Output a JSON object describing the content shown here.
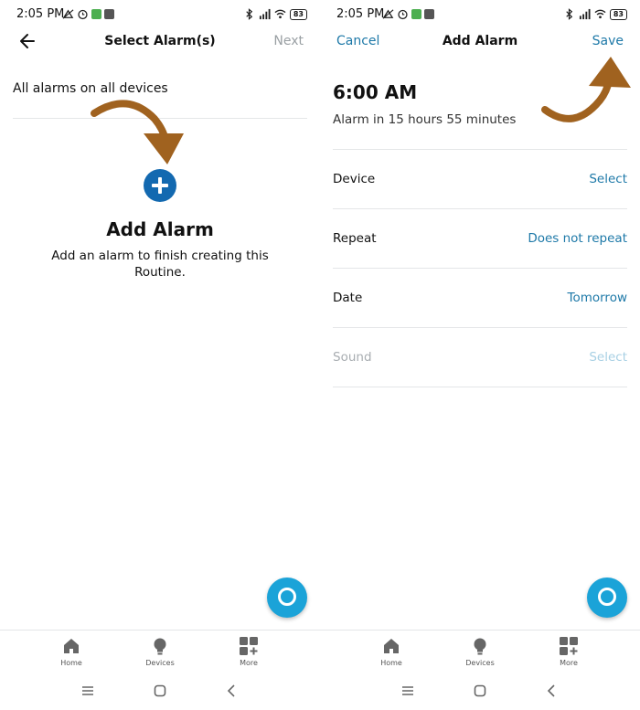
{
  "status_bar": {
    "time": "2:05 PM",
    "battery": "83",
    "icons": [
      "notification-icon",
      "alarm-clock-icon",
      "app-icon",
      "app-icon",
      "bluetooth-icon",
      "signal-icon",
      "wifi-icon",
      "battery-icon"
    ]
  },
  "left_screen": {
    "title": "Select Alarm(s)",
    "next_label": "Next",
    "all_alarms_label": "All alarms on all devices",
    "add_alarm_title": "Add Alarm",
    "add_alarm_description": "Add an alarm to finish creating this Routine."
  },
  "right_screen": {
    "title": "Add Alarm",
    "cancel_label": "Cancel",
    "save_label": "Save",
    "alarm_time": "6:00 AM",
    "alarm_countdown": "Alarm in 15 hours 55 minutes",
    "rows": [
      {
        "label": "Device",
        "value": "Select",
        "enabled": true
      },
      {
        "label": "Repeat",
        "value": "Does not repeat",
        "enabled": true
      },
      {
        "label": "Date",
        "value": "Tomorrow",
        "enabled": true
      },
      {
        "label": "Sound",
        "value": "Select",
        "enabled": false
      }
    ]
  },
  "tabs": [
    {
      "label": "Home",
      "icon": "home-icon"
    },
    {
      "label": "Devices",
      "icon": "lightbulb-icon"
    },
    {
      "label": "More",
      "icon": "grid-plus-icon"
    }
  ],
  "colors": {
    "accent": "#1e79a8",
    "add_button": "#1369b0",
    "alexa_button": "#1ba3d8",
    "annotation_arrow": "#a0621f"
  }
}
